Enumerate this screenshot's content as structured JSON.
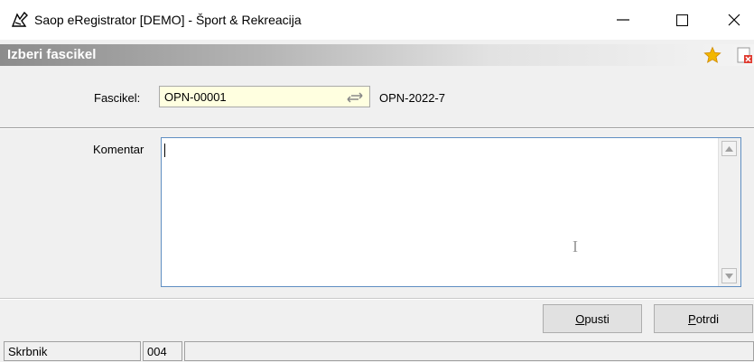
{
  "window": {
    "title": "Saop eRegistrator [DEMO] - Šport & Rekreacija",
    "minimize_glyph": "—",
    "maximize_glyph": "☐",
    "close_glyph": "✕"
  },
  "panel": {
    "title": "Izberi fascikel"
  },
  "form": {
    "fascikel_label": "Fascikel:",
    "fascikel_value": "OPN-00001",
    "fascikel_desc": "OPN-2022-7",
    "komentar_label": "Komentar",
    "komentar_value": ""
  },
  "buttons": {
    "opusti_first": "O",
    "opusti_rest": "pusti",
    "potrdi_first": "P",
    "potrdi_rest": "otrdi"
  },
  "status": {
    "label": "Skrbnik",
    "code": "004",
    "extra": ""
  },
  "icons": [
    "app-icon",
    "star-icon",
    "close-document-icon",
    "swap-arrows-icon",
    "scroll-up-icon",
    "scroll-down-icon"
  ],
  "colors": {
    "input_bg": "#ffffe0",
    "star": "#f2b700",
    "focus_border": "#5f8ec2"
  }
}
